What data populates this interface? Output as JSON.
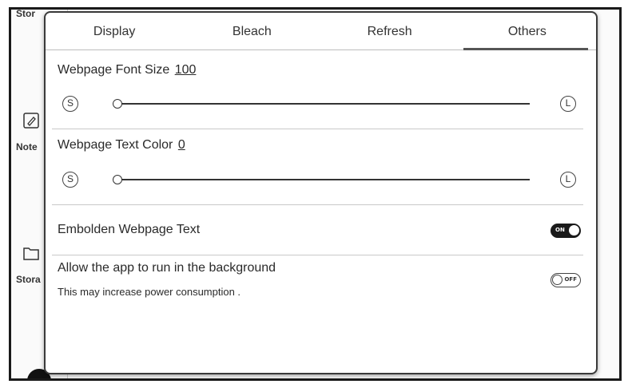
{
  "background_app": {
    "sidebar_labels": [
      "Stor",
      "Note",
      "Stora"
    ]
  },
  "tabs": [
    {
      "label": "Display",
      "active": false
    },
    {
      "label": "Bleach",
      "active": false
    },
    {
      "label": "Refresh",
      "active": false
    },
    {
      "label": "Others",
      "active": true
    }
  ],
  "font_size": {
    "title": "Webpage Font Size",
    "value": "100",
    "min_label": "S",
    "max_label": "L",
    "slider_fraction": 0.0
  },
  "text_color": {
    "title": "Webpage Text Color",
    "value": "0",
    "min_label": "S",
    "max_label": "L",
    "slider_fraction": 0.0
  },
  "embolden": {
    "label": "Embolden Webpage Text",
    "toggle_text": "ON",
    "state": "on"
  },
  "background_run": {
    "label": "Allow the app to run in the background",
    "sublabel": "This may increase power consumption .",
    "toggle_text": "OFF",
    "state": "off"
  }
}
